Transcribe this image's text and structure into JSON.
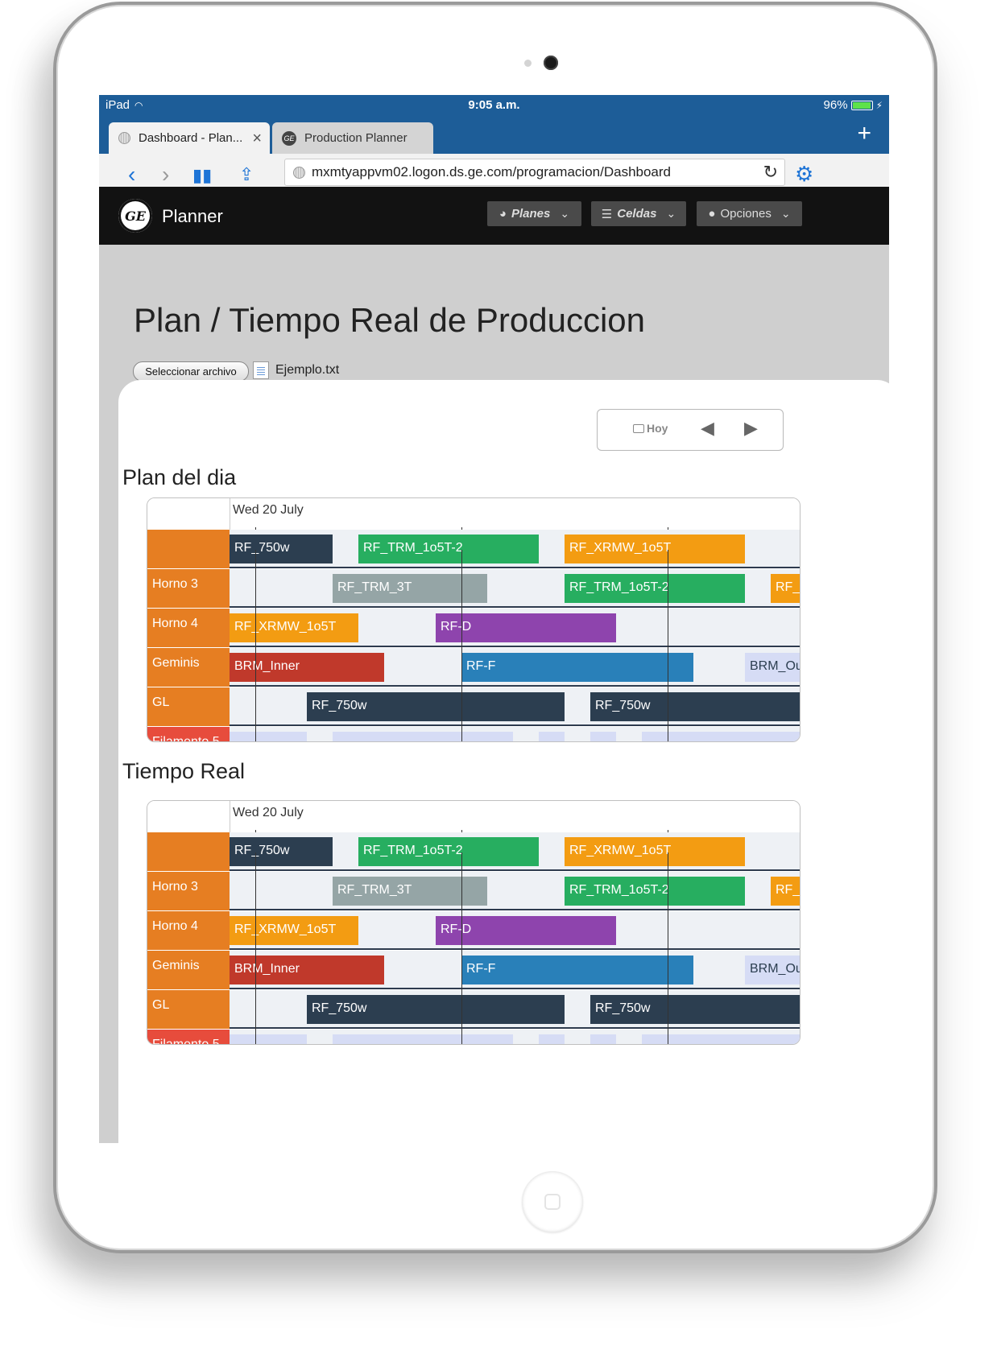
{
  "status_bar": {
    "device": "iPad",
    "time": "9:05 a.m.",
    "battery": "96%"
  },
  "tabs": [
    {
      "title": "Dashboard - Plan...",
      "active": true
    },
    {
      "title": "Production Planner",
      "active": false
    }
  ],
  "url": "mxmtyappvm02.logon.ds.ge.com/programacion/Dashboard",
  "app": {
    "brand": "Planner",
    "menu": [
      {
        "label": "Planes",
        "icon": "dashboard-icon"
      },
      {
        "label": "Celdas",
        "icon": "server-icon"
      },
      {
        "label": "Opciones",
        "icon": "user-icon"
      }
    ]
  },
  "page": {
    "title": "Plan / Tiempo Real de Produccion",
    "file_button": "Seleccionar archivo",
    "file_name": "Ejemplo.txt",
    "today_label": "Hoy"
  },
  "colors": {
    "status_bar": "#1d5d98",
    "nav": "#121212",
    "row_label": "#e67e22",
    "navy": "#2c3e50",
    "green": "#27ae60",
    "orange": "#f39c12",
    "gray": "#95a5a6",
    "purple": "#8e44ad",
    "red": "#c0392b",
    "blue": "#2980b9",
    "lavender": "#d6dcf5",
    "filamento": "#e74c3c"
  },
  "timelines": [
    {
      "title": "Plan del dia",
      "date": "Wed 20 July",
      "hours": [
        "08:00",
        "12:00",
        "16:00"
      ],
      "rows": [
        {
          "label": "",
          "bars": [
            {
              "text": "RF_750w",
              "start": 7.5,
              "end": 9.5,
              "color": "navy"
            },
            {
              "text": "RF_TRM_1o5T-2",
              "start": 10.0,
              "end": 13.5,
              "color": "green"
            },
            {
              "text": "RF_XRMW_1o5T",
              "start": 14.0,
              "end": 17.5,
              "color": "orange"
            }
          ]
        },
        {
          "label": "Horno 3",
          "bars": [
            {
              "text": "RF_TRM_3T",
              "start": 9.5,
              "end": 12.5,
              "color": "gray"
            },
            {
              "text": "RF_TRM_1o5T-2",
              "start": 14.0,
              "end": 17.5,
              "color": "green"
            },
            {
              "text": "RF_XRMW_1o5T",
              "start": 18.0,
              "end": 19.5,
              "color": "orange"
            }
          ]
        },
        {
          "label": "Horno 4",
          "bars": [
            {
              "text": "RF_XRMW_1o5T",
              "start": 7.5,
              "end": 10.0,
              "color": "orange"
            },
            {
              "text": "RF-D",
              "start": 11.5,
              "end": 15.0,
              "color": "purple"
            },
            {
              "text": "",
              "start": 19.0,
              "end": 19.5,
              "color": "gray"
            }
          ]
        },
        {
          "label": "Geminis",
          "bars": [
            {
              "text": "BRM_Inner",
              "start": 7.5,
              "end": 10.5,
              "color": "red"
            },
            {
              "text": "RF-F",
              "start": 12.0,
              "end": 16.5,
              "color": "blue"
            },
            {
              "text": "BRM_Outer",
              "start": 17.5,
              "end": 19.5,
              "color": "lavender"
            }
          ]
        },
        {
          "label": "GL",
          "bars": [
            {
              "text": "RF_750w",
              "start": 9.0,
              "end": 14.0,
              "color": "navy"
            },
            {
              "text": "RF_750w",
              "start": 14.5,
              "end": 19.5,
              "color": "navy"
            }
          ]
        },
        {
          "label": "Filamento 5",
          "bars": [
            {
              "text": "",
              "start": 7.5,
              "end": 9.0,
              "color": "lavender"
            },
            {
              "text": "",
              "start": 9.5,
              "end": 13.0,
              "color": "lavender"
            },
            {
              "text": "",
              "start": 13.5,
              "end": 14.0,
              "color": "lavender"
            },
            {
              "text": "",
              "start": 14.5,
              "end": 15.0,
              "color": "lavender"
            },
            {
              "text": "",
              "start": 15.5,
              "end": 19.5,
              "color": "lavender"
            }
          ]
        }
      ]
    },
    {
      "title": "Tiempo Real",
      "date": "Wed 20 July",
      "hours": [
        "08:00",
        "12:00",
        "16:00"
      ],
      "rows": [
        {
          "label": "",
          "bars": [
            {
              "text": "RF_750w",
              "start": 7.5,
              "end": 9.5,
              "color": "navy"
            },
            {
              "text": "RF_TRM_1o5T-2",
              "start": 10.0,
              "end": 13.5,
              "color": "green"
            },
            {
              "text": "RF_XRMW_1o5T",
              "start": 14.0,
              "end": 17.5,
              "color": "orange"
            }
          ]
        },
        {
          "label": "Horno 3",
          "bars": [
            {
              "text": "RF_TRM_3T",
              "start": 9.5,
              "end": 12.5,
              "color": "gray"
            },
            {
              "text": "RF_TRM_1o5T-2",
              "start": 14.0,
              "end": 17.5,
              "color": "green"
            },
            {
              "text": "RF_XRMW_1o5T",
              "start": 18.0,
              "end": 19.5,
              "color": "orange"
            }
          ]
        },
        {
          "label": "Horno 4",
          "bars": [
            {
              "text": "RF_XRMW_1o5T",
              "start": 7.5,
              "end": 10.0,
              "color": "orange"
            },
            {
              "text": "RF-D",
              "start": 11.5,
              "end": 15.0,
              "color": "purple"
            },
            {
              "text": "",
              "start": 19.0,
              "end": 19.5,
              "color": "gray"
            }
          ]
        },
        {
          "label": "Geminis",
          "bars": [
            {
              "text": "BRM_Inner",
              "start": 7.5,
              "end": 10.5,
              "color": "red"
            },
            {
              "text": "RF-F",
              "start": 12.0,
              "end": 16.5,
              "color": "blue"
            },
            {
              "text": "BRM_Outer",
              "start": 17.5,
              "end": 19.5,
              "color": "lavender"
            }
          ]
        },
        {
          "label": "GL",
          "bars": [
            {
              "text": "RF_750w",
              "start": 9.0,
              "end": 14.0,
              "color": "navy"
            },
            {
              "text": "RF_750w",
              "start": 14.5,
              "end": 19.5,
              "color": "navy"
            }
          ]
        },
        {
          "label": "Filamento 5",
          "bars": [
            {
              "text": "",
              "start": 7.5,
              "end": 9.0,
              "color": "lavender"
            },
            {
              "text": "",
              "start": 9.5,
              "end": 13.0,
              "color": "lavender"
            },
            {
              "text": "",
              "start": 13.5,
              "end": 14.0,
              "color": "lavender"
            },
            {
              "text": "",
              "start": 14.5,
              "end": 15.0,
              "color": "lavender"
            },
            {
              "text": "",
              "start": 15.5,
              "end": 19.5,
              "color": "lavender"
            }
          ]
        }
      ]
    }
  ]
}
